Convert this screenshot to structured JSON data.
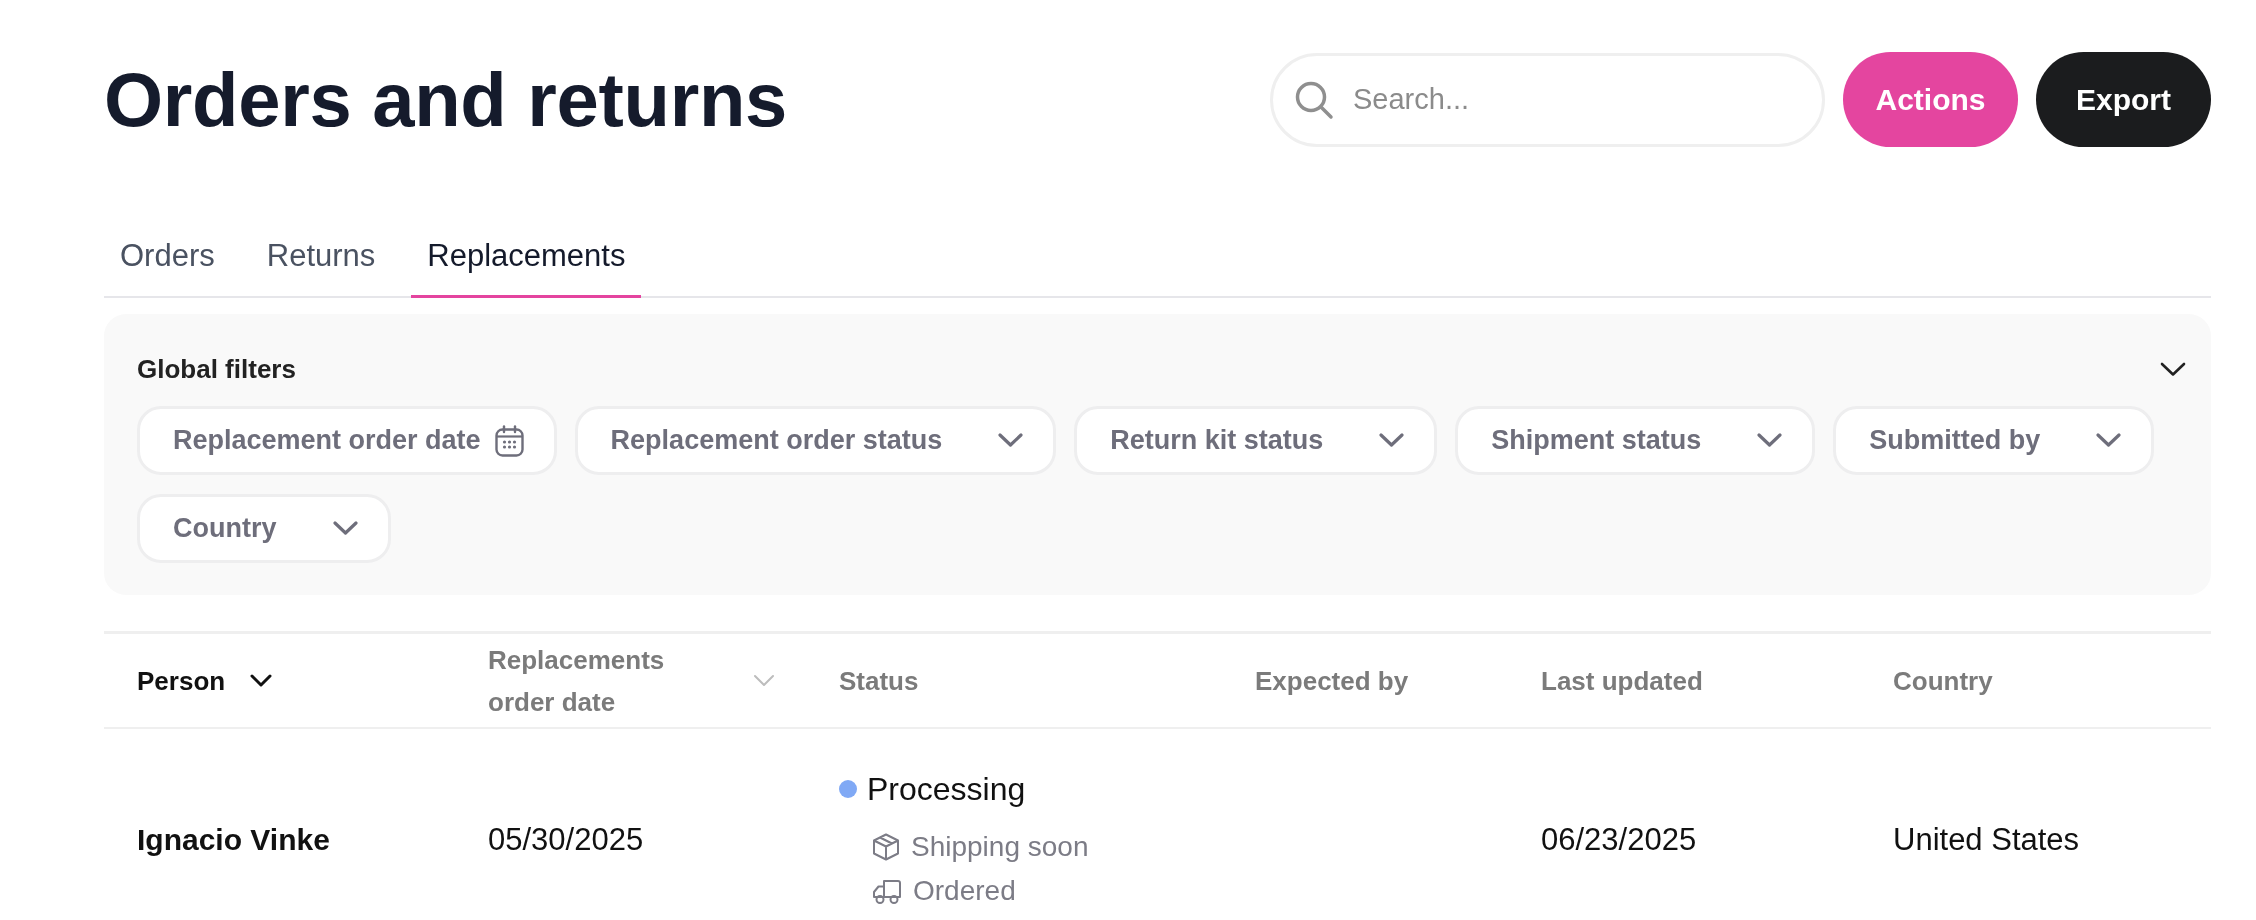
{
  "page": {
    "title": "Orders and returns"
  },
  "search": {
    "placeholder": "Search..."
  },
  "buttons": [
    {
      "label": "Actions",
      "kind": "primary"
    },
    {
      "label": "Export",
      "kind": "secondary"
    }
  ],
  "tabs": [
    {
      "label": "Orders",
      "selected": false
    },
    {
      "label": "Returns",
      "selected": false
    },
    {
      "label": "Replacements",
      "selected": true
    }
  ],
  "filters": {
    "title": "Global filters",
    "expanded": true,
    "items": [
      {
        "label": "Replacement order date",
        "kind": "date"
      },
      {
        "label": "Replacement order status",
        "kind": "select"
      },
      {
        "label": "Return kit status",
        "kind": "select"
      },
      {
        "label": "Shipment status",
        "kind": "select"
      },
      {
        "label": "Submitted by",
        "kind": "select"
      },
      {
        "label": "Country",
        "kind": "select"
      }
    ]
  },
  "table": {
    "columns": [
      {
        "label": "Person",
        "sortable": true,
        "sorted": true
      },
      {
        "label": "Replacements order date",
        "sortable": true,
        "sorted": false
      },
      {
        "label": "Status",
        "sortable": false,
        "sorted": false
      },
      {
        "label": "Expected by",
        "sortable": false,
        "sorted": false
      },
      {
        "label": "Last updated",
        "sortable": false,
        "sorted": false
      },
      {
        "label": "Country",
        "sortable": false,
        "sorted": false
      }
    ],
    "rows": [
      {
        "person": "Ignacio Vinke",
        "order_date": "05/30/2025",
        "status": {
          "label": "Processing",
          "color": "#80a9f5",
          "details": [
            {
              "label": "Shipping soon",
              "kind": "box"
            },
            {
              "label": "Ordered",
              "kind": "truck"
            }
          ]
        },
        "last_updated": "06/23/2025",
        "country": "United States"
      }
    ]
  }
}
